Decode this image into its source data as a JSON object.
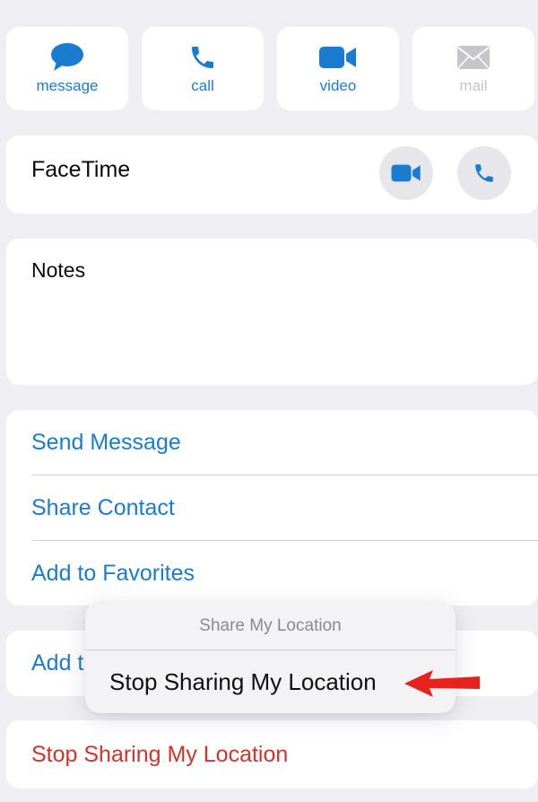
{
  "actions": [
    {
      "label": "message",
      "icon": "message-bubble-icon",
      "enabled": true
    },
    {
      "label": "call",
      "icon": "phone-icon",
      "enabled": true
    },
    {
      "label": "video",
      "icon": "video-camera-icon",
      "enabled": true
    },
    {
      "label": "mail",
      "icon": "mail-envelope-icon",
      "enabled": false
    }
  ],
  "facetime": {
    "label": "FaceTime",
    "buttons": [
      "video-camera-icon",
      "phone-icon"
    ]
  },
  "notes": {
    "label": "Notes"
  },
  "options": [
    {
      "label": "Send Message"
    },
    {
      "label": "Share Contact"
    },
    {
      "label": "Add to Favorites"
    }
  ],
  "add_row_partial": "Add t",
  "stop_sharing": {
    "label": "Stop Sharing My Location"
  },
  "popup": {
    "title": "Share My Location",
    "item": "Stop Sharing My Location"
  },
  "annotation": {
    "icon": "red-arrow-icon",
    "color": "#e8231e"
  },
  "colors": {
    "accent": "#1a7cd1",
    "destructive": "#d6322a",
    "background": "#eeeef3",
    "disabled": "#c5c5ca"
  }
}
